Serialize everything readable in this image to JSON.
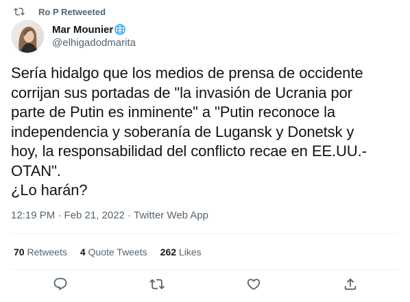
{
  "retweet_banner": {
    "text": "Ro P Retweeted",
    "icon": "retweet-icon"
  },
  "author": {
    "name": "Mar Mounier",
    "handle": "@elhigadodmarita",
    "badge_icon": "globe-icon"
  },
  "tweet": {
    "text": "Sería hidalgo que los medios de prensa de occidente\ncorrijan sus portadas de \"la invasión de Ucrania por\nparte de Putin es inminente\" a \"Putin reconoce la\nindependencia y soberanía de Lugansk y Donetsk y\nhoy, la responsabilidad del conflicto recae en EE.UU.-\nOTAN\".\n¿Lo harán?",
    "timestamp": "12:19 PM · Feb 21, 2022 · Twitter Web App"
  },
  "stats": {
    "retweets_count": "70",
    "retweets_label": "Retweets",
    "quotes_count": "4",
    "quotes_label": "Quote Tweets",
    "likes_count": "262",
    "likes_label": "Likes"
  },
  "actions": {
    "reply_icon": "reply-icon",
    "retweet_icon": "retweet-icon",
    "like_icon": "heart-icon",
    "share_icon": "share-icon"
  },
  "colors": {
    "primary_text": "#0f1419",
    "secondary_text": "#536471",
    "divider": "#eff3f4",
    "globe_blue": "#1d9bf0"
  }
}
